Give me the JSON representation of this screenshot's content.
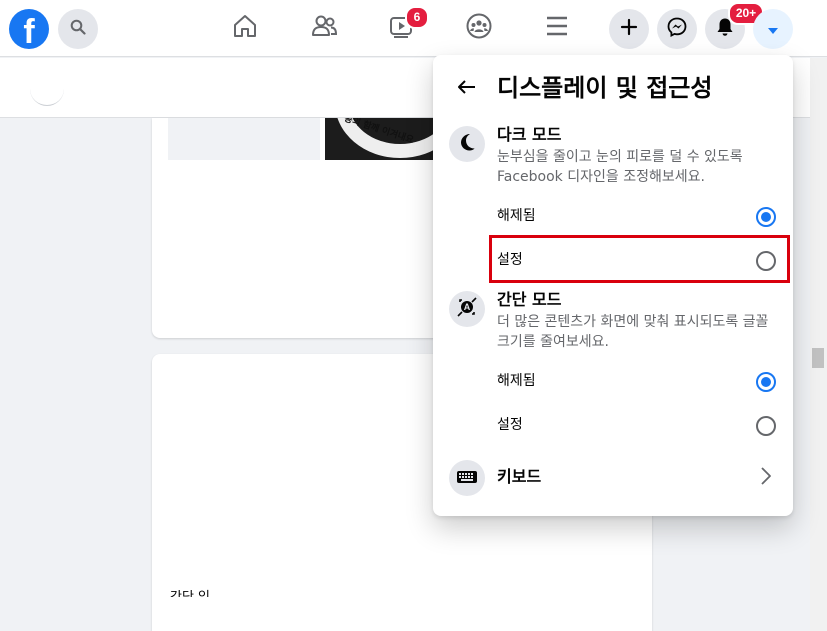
{
  "nav": {
    "logo_text": "f",
    "watch_badge": "6",
    "notifications_badge": "20+",
    "icons": [
      "search-icon",
      "home-icon",
      "friends-icon",
      "watch-icon",
      "groups-icon",
      "menu-icon",
      "create-icon",
      "messenger-icon",
      "bell-icon",
      "caret-down-icon"
    ]
  },
  "feed": {
    "image_text": "동의 함께 이겨내요",
    "cut_text": "간단 잉"
  },
  "panel": {
    "title": "디스플레이 및 접근성",
    "dark_mode": {
      "title": "다크 모드",
      "description": "눈부심을 줄이고 눈의 피로를 덜 수 있도록 Facebook 디자인을 조정해보세요.",
      "options": [
        {
          "label": "해제됨",
          "selected": true
        },
        {
          "label": "설정",
          "selected": false
        }
      ]
    },
    "compact_mode": {
      "title": "간단 모드",
      "description": "더 많은 콘텐츠가 화면에 맞춰 표시되도록 글꼴 크기를 줄여보세요.",
      "options": [
        {
          "label": "해제됨",
          "selected": true
        },
        {
          "label": "설정",
          "selected": false
        }
      ]
    },
    "keyboard": {
      "title": "키보드"
    }
  },
  "colors": {
    "brand": "#1877f2",
    "badge": "#e41e3f",
    "highlight": "#d9000d"
  }
}
